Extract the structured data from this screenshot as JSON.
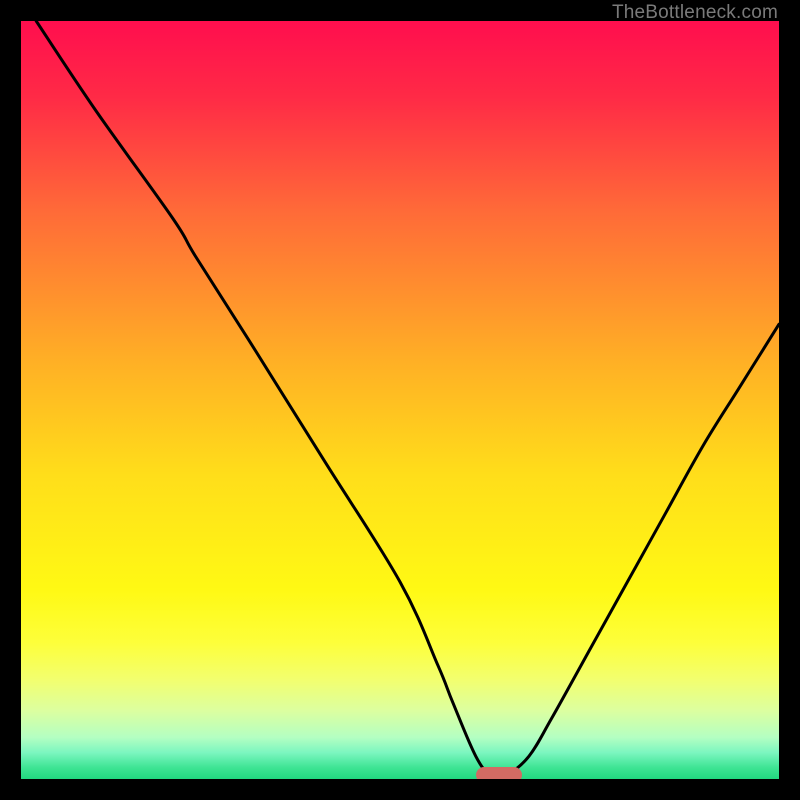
{
  "watermark": "TheBottleneck.com",
  "chart_data": {
    "type": "line",
    "title": "",
    "xlabel": "",
    "ylabel": "",
    "xlim": [
      0,
      100
    ],
    "ylim": [
      0,
      100
    ],
    "series": [
      {
        "name": "bottleneck-curve",
        "x": [
          2,
          10,
          20,
          23,
          30,
          40,
          50,
          55,
          57,
          60,
          62,
          64,
          67,
          70,
          75,
          80,
          85,
          90,
          95,
          100
        ],
        "y": [
          100,
          88,
          74,
          69,
          58,
          42,
          26,
          15,
          10,
          3,
          0.5,
          0.5,
          3,
          8,
          17,
          26,
          35,
          44,
          52,
          60
        ]
      }
    ],
    "gradient_stops": [
      {
        "offset": 0.0,
        "color": "#ff0e4e"
      },
      {
        "offset": 0.1,
        "color": "#ff2a46"
      },
      {
        "offset": 0.25,
        "color": "#ff6a38"
      },
      {
        "offset": 0.45,
        "color": "#ffb025"
      },
      {
        "offset": 0.6,
        "color": "#ffde1a"
      },
      {
        "offset": 0.75,
        "color": "#fff914"
      },
      {
        "offset": 0.82,
        "color": "#fdff3a"
      },
      {
        "offset": 0.87,
        "color": "#f2ff70"
      },
      {
        "offset": 0.91,
        "color": "#dcffa0"
      },
      {
        "offset": 0.945,
        "color": "#b4ffc2"
      },
      {
        "offset": 0.965,
        "color": "#7cf6c0"
      },
      {
        "offset": 0.985,
        "color": "#3ee494"
      },
      {
        "offset": 1.0,
        "color": "#21d87f"
      }
    ],
    "marker": {
      "x": 63,
      "y": 0.5,
      "color": "#d26b63"
    },
    "curve_stroke": "#000000",
    "curve_width": 3
  }
}
